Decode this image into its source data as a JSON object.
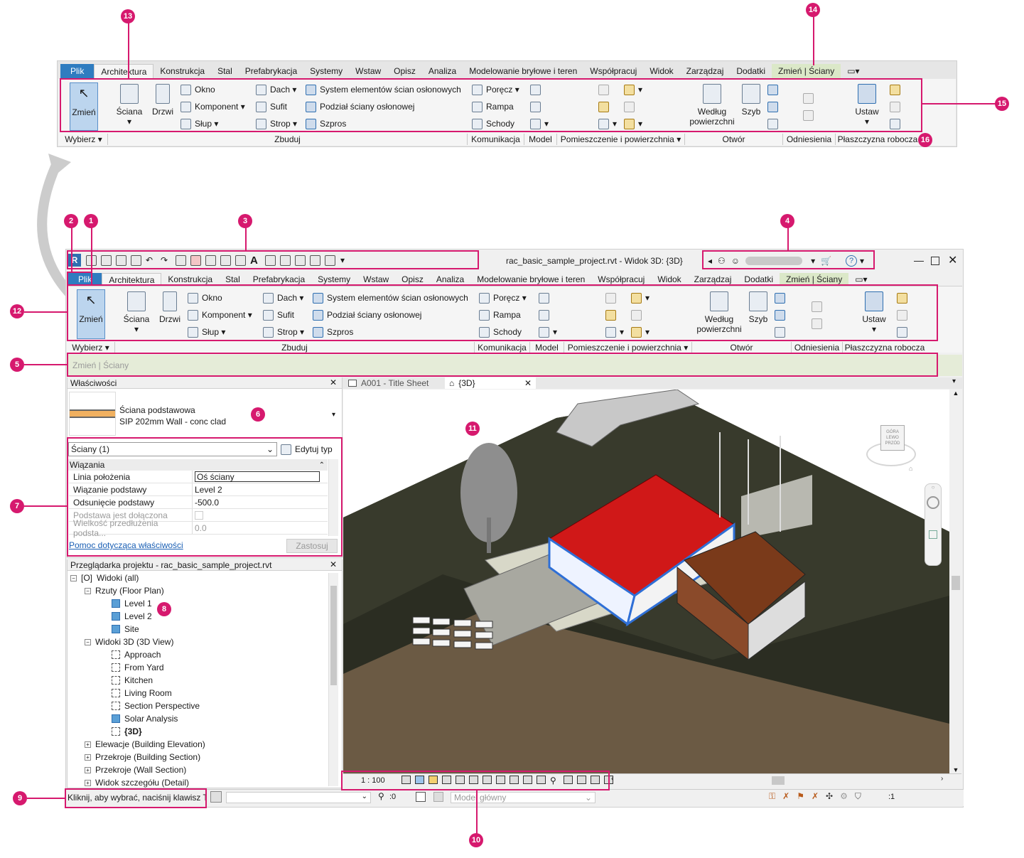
{
  "callouts": [
    "1",
    "2",
    "3",
    "4",
    "5",
    "6",
    "7",
    "8",
    "9",
    "10",
    "11",
    "12",
    "13",
    "14",
    "15",
    "16"
  ],
  "ribbon": {
    "tabs": [
      "Plik",
      "Architektura",
      "Konstrukcja",
      "Stal",
      "Prefabrykacja",
      "Systemy",
      "Wstaw",
      "Opisz",
      "Analiza",
      "Modelowanie bryłowe i teren",
      "Współpracuj",
      "Widok",
      "Zarządzaj",
      "Dodatki",
      "Zmień | Ściany"
    ],
    "select": {
      "zmien": "Zmień",
      "wybierz": "Wybierz"
    },
    "build": {
      "sciana": "Ściana",
      "drzwi": "Drzwi",
      "okno": "Okno",
      "komponent": "Komponent",
      "slup": "Słup",
      "dach": "Dach",
      "sufit": "Sufit",
      "strop": "Strop",
      "system": "System elementów ścian osłonowych",
      "podzial": "Podział ściany osłonowej",
      "szpros": "Szpros",
      "label": "Zbuduj"
    },
    "circ": {
      "porecz": "Poręcz",
      "rampa": "Rampa",
      "schody": "Schody",
      "label": "Komunikacja"
    },
    "model_label": "Model",
    "room_label": "Pomieszczenie i powierzchnia",
    "opening": {
      "wedlug1": "Według",
      "wedlug2": "powierzchni",
      "szyb": "Szyb",
      "label": "Otwór"
    },
    "datum_label": "Odniesienia",
    "workplane": {
      "ustaw": "Ustaw",
      "label": "Płaszczyzna robocza"
    }
  },
  "window": {
    "title": "rac_basic_sample_project.rvt - Widok 3D: {3D}"
  },
  "options_bar": {
    "text": "Zmień | Ściany"
  },
  "properties": {
    "title": "Właściwości",
    "type_name": "Ściana podstawowa",
    "type_sub": "SIP 202mm Wall - conc clad",
    "filter": "Ściany (1)",
    "edit_type": "Edytuj typ",
    "group": "Wiązania",
    "rows": [
      {
        "k": "Linia położenia",
        "v": "Oś ściany"
      },
      {
        "k": "Wiązanie podstawy",
        "v": "Level 2"
      },
      {
        "k": "Odsunięcie podstawy",
        "v": "-500.0"
      },
      {
        "k": "Podstawa jest dołączona",
        "v": ""
      },
      {
        "k": "Wielkość przedłużenia podsta...",
        "v": "0.0"
      }
    ],
    "help": "Pomoc dotycząca właściwości",
    "apply": "Zastosuj"
  },
  "browser": {
    "title": "Przeglądarka projektu - rac_basic_sample_project.rvt",
    "items": [
      "Widoki (all)",
      "Rzuty (Floor Plan)",
      "Level 1",
      "Level 2",
      "Site",
      "Widoki 3D (3D View)",
      "Approach",
      "From Yard",
      "Kitchen",
      "Living Room",
      "Section Perspective",
      "Solar Analysis",
      "{3D}",
      "Elewacje (Building Elevation)",
      "Przekroje (Building Section)",
      "Przekroje (Wall Section)",
      "Widok szczegółu (Detail)"
    ]
  },
  "view_tabs": [
    "A001 - Title Sheet",
    "{3D}"
  ],
  "view_control": {
    "scale": "1 : 100"
  },
  "viewcube": {
    "left": "LEWO",
    "front": "PRZÓD",
    "top": "GÓRA"
  },
  "status": {
    "prompt": "Kliknij, aby wybrać, naciśnij klawisz T",
    "workset_count": ":0",
    "model": "Model główny",
    "filter": ":1"
  }
}
